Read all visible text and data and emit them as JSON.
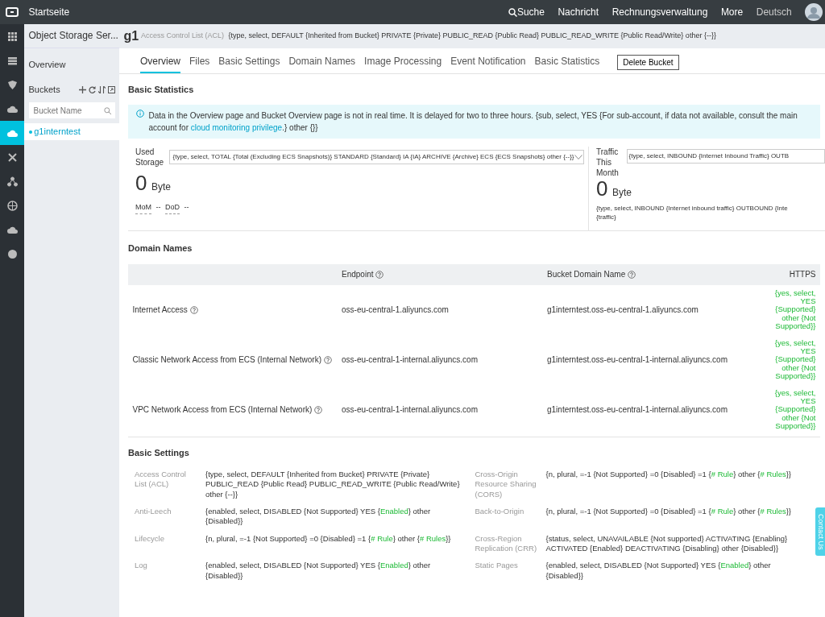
{
  "topbar": {
    "home": "Startseite",
    "search": "Suche",
    "links": [
      "Nachricht",
      "Rechnungsverwaltung",
      "More"
    ],
    "language": "Deutsch"
  },
  "icon_rail": [
    {
      "kind": "grid",
      "selected": false
    },
    {
      "kind": "list",
      "selected": false
    },
    {
      "kind": "shield",
      "selected": false
    },
    {
      "kind": "cloud",
      "selected": false
    },
    {
      "kind": "cloud",
      "selected": true
    },
    {
      "kind": "cross",
      "selected": false
    },
    {
      "kind": "nodes",
      "selected": false
    },
    {
      "kind": "globe",
      "selected": false
    },
    {
      "kind": "cloud",
      "selected": false
    },
    {
      "kind": "dot",
      "selected": false
    }
  ],
  "sidebar": {
    "title": "Object Storage Ser...",
    "items": [
      {
        "label": "Overview"
      }
    ],
    "buckets_label": "Buckets",
    "search": {
      "placeholder": "Bucket Name"
    },
    "buckets": [
      {
        "name": "g1interntest",
        "selected": true
      }
    ]
  },
  "header": {
    "bucket": "g1",
    "acl_label": "Access Control List (ACL)",
    "acl_value": "{type, select, DEFAULT {Inherited from Bucket} PRIVATE {Private} PUBLIC_READ {Public Read} PUBLIC_READ_WRITE {Public Read/Write} other {--}}"
  },
  "tabs": [
    {
      "label": "Overview",
      "selected": true
    },
    {
      "label": "Files",
      "selected": false
    },
    {
      "label": "Basic Settings",
      "selected": false
    },
    {
      "label": "Domain Names",
      "selected": false
    },
    {
      "label": "Image Processing",
      "selected": false
    },
    {
      "label": "Event Notification",
      "selected": false
    },
    {
      "label": "Basic Statistics",
      "selected": false
    }
  ],
  "delete_button": "Delete Bucket",
  "basic_statistics": {
    "title": "Basic Statistics",
    "notice": {
      "text": "Data in the Overview page and Bucket Overview page is not in real time. It is delayed for two to three hours. {sub, select, YES {For sub-account, if data not available, consult the main account for",
      "link": "cloud monitoring privilege",
      "after": ".} other {}}"
    },
    "storage": {
      "label": "Used Storage",
      "select": "{type, select, TOTAL {Total (Excluding ECS Snapshots)} STANDARD {Standard} IA {IA} ARCHIVE {Archive} ECS {ECS Snapshots} other {--}}",
      "value": "0",
      "unit": "Byte",
      "mom_label": "MoM",
      "mom": "--",
      "dod_label": "DoD",
      "dod": "--"
    },
    "traffic": {
      "label": "Traffic This Month",
      "select": "{type, select, INBOUND {Internet Inbound Traffic} OUTB",
      "value": "0",
      "unit": "Byte",
      "lines": [
        "{type, select, INBOUND {Internet inbound traffic} OUTBOUND {Inte",
        "{traffic}"
      ]
    }
  },
  "domain_names": {
    "title": "Domain Names",
    "columns": [
      {
        "label": "Endpoint",
        "help": true
      },
      {
        "label": "Bucket Domain Name",
        "help": true
      },
      {
        "label": "HTTPS",
        "help": false
      }
    ],
    "rows": [
      {
        "access": "Internet Access",
        "endpoint": "oss-eu-central-1.aliyuncs.com",
        "domain": "g1interntest.oss-eu-central-1.aliyuncs.com",
        "https": "{yes, select, YES {Supported} other {Not Supported}}"
      },
      {
        "access": "Classic Network Access from ECS (Internal Network)",
        "endpoint": "oss-eu-central-1-internal.aliyuncs.com",
        "domain": "g1interntest.oss-eu-central-1-internal.aliyuncs.com",
        "https": "{yes, select, YES {Supported} other {Not Supported}}"
      },
      {
        "access": "VPC Network Access from ECS (Internal Network)",
        "endpoint": "oss-eu-central-1-internal.aliyuncs.com",
        "domain": "g1interntest.oss-eu-central-1-internal.aliyuncs.com",
        "https": "{yes, select, YES {Supported} other {Not Supported}}"
      }
    ]
  },
  "basic_settings": {
    "title": "Basic Settings",
    "items": [
      {
        "label": "Access Control List (ACL)",
        "parts": [
          {
            "text": "{type, select, DEFAULT {Inherited from Bucket} PRIVATE {Private} PUBLIC_READ {Public Read} PUBLIC_READ_WRITE {Public Read/Write} other {--}}",
            "highlight": false
          }
        ]
      },
      {
        "label": "Cross-Origin Resource Sharing (CORS)",
        "parts": [
          {
            "text": "{n, plural, =-1 {Not Supported} =0 {Disabled} =1 {",
            "highlight": false
          },
          {
            "text": "# Rule",
            "highlight": true
          },
          {
            "text": "} other {",
            "highlight": false
          },
          {
            "text": "# Rules",
            "highlight": true
          },
          {
            "text": "}}",
            "highlight": false
          }
        ]
      },
      {
        "label": "Anti-Leech",
        "parts": [
          {
            "text": "{enabled, select, DISABLED {Not Supported} YES {",
            "highlight": false
          },
          {
            "text": "Enabled",
            "highlight": true
          },
          {
            "text": "} other {Disabled}}",
            "highlight": false
          }
        ]
      },
      {
        "label": "Back-to-Origin",
        "parts": [
          {
            "text": "{n, plural, =-1 {Not Supported} =0 {Disabled} =1 {",
            "highlight": false
          },
          {
            "text": "# Rule",
            "highlight": true
          },
          {
            "text": "} other {",
            "highlight": false
          },
          {
            "text": "# Rules",
            "highlight": true
          },
          {
            "text": "}}",
            "highlight": false
          }
        ]
      },
      {
        "label": "Lifecycle",
        "parts": [
          {
            "text": "{n, plural, =-1 {Not Supported} =0 {Disabled} =1 {",
            "highlight": false
          },
          {
            "text": "# Rule",
            "highlight": true
          },
          {
            "text": "} other {",
            "highlight": false
          },
          {
            "text": "# Rules",
            "highlight": true
          },
          {
            "text": "}}",
            "highlight": false
          }
        ]
      },
      {
        "label": "Cross-Region Replication (CRR)",
        "parts": [
          {
            "text": "{status, select, UNAVAILABLE {Not supported} ACTIVATING {Enabling} ACTIVATED {Enabled} DEACTIVATING {Disabling} other {Disabled}}",
            "highlight": false
          }
        ]
      },
      {
        "label": "Log",
        "parts": [
          {
            "text": "{enabled, select, DISABLED {Not Supported} YES {",
            "highlight": false
          },
          {
            "text": "Enabled",
            "highlight": true
          },
          {
            "text": "} other {Disabled}}",
            "highlight": false
          }
        ]
      },
      {
        "label": "Static Pages",
        "parts": [
          {
            "text": "{enabled, select, DISABLED {Not Supported} YES {",
            "highlight": false
          },
          {
            "text": "Enabled",
            "highlight": true
          },
          {
            "text": "} other {Disabled}}",
            "highlight": false
          }
        ]
      }
    ]
  },
  "contact": "Contact Us"
}
